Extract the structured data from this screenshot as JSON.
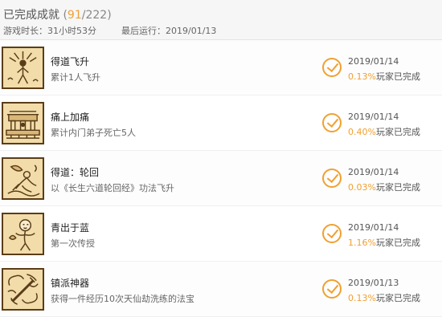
{
  "header": {
    "title": "已完成成就",
    "open_paren": "(",
    "completed": "91",
    "total": "/222)",
    "playtime_label": "游戏时长：",
    "playtime_value": "31小时53分",
    "lastrun_label": "最后运行：",
    "lastrun_value": "2019/01/13"
  },
  "common": {
    "rate_suffix": "玩家已完成"
  },
  "achievements": [
    {
      "name": "得道飞升",
      "desc": "累计1人飞升",
      "date": "2019/01/14",
      "rate": "0.13%",
      "icon": "ascension-icon"
    },
    {
      "name": "痛上加痛",
      "desc": "累计内门弟子死亡5人",
      "date": "2019/01/14",
      "rate": "0.40%",
      "icon": "altar-icon"
    },
    {
      "name": "得道：轮回",
      "desc": "以《长生六道轮回经》功法飞升",
      "date": "2019/01/14",
      "rate": "0.03%",
      "icon": "reincarnation-icon"
    },
    {
      "name": "青出于蓝",
      "desc": "第一次传授",
      "date": "2019/01/14",
      "rate": "1.16%",
      "icon": "disciple-icon"
    },
    {
      "name": "镇派神器",
      "desc": "获得一件经历10次天仙劫洗练的法宝",
      "date": "2019/01/13",
      "rate": "0.13%",
      "icon": "artifact-icon"
    }
  ]
}
